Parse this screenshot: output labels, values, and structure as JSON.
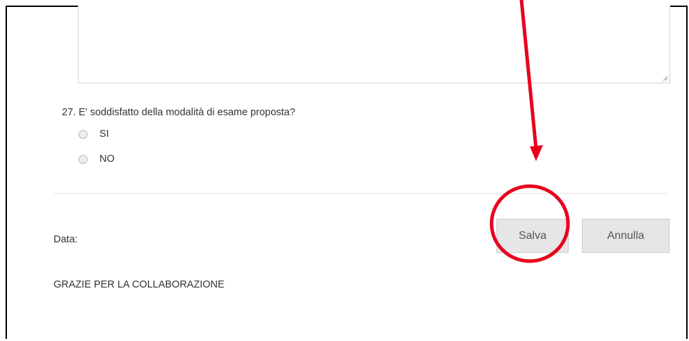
{
  "form": {
    "question_27": {
      "text": "27. E' soddisfatto della modalità di esame proposta?",
      "options": [
        "SI",
        "NO"
      ]
    },
    "date_label": "Data:",
    "thanks_text": "GRAZIE PER LA COLLABORAZIONE"
  },
  "buttons": {
    "save_label": "Salva",
    "cancel_label": "Annulla"
  },
  "icons": {
    "resize": "resize-grip-icon",
    "radio": "radio-empty"
  },
  "colors": {
    "annotation": "#e8001c",
    "button_bg": "#e6e6e6",
    "text": "#333333"
  }
}
